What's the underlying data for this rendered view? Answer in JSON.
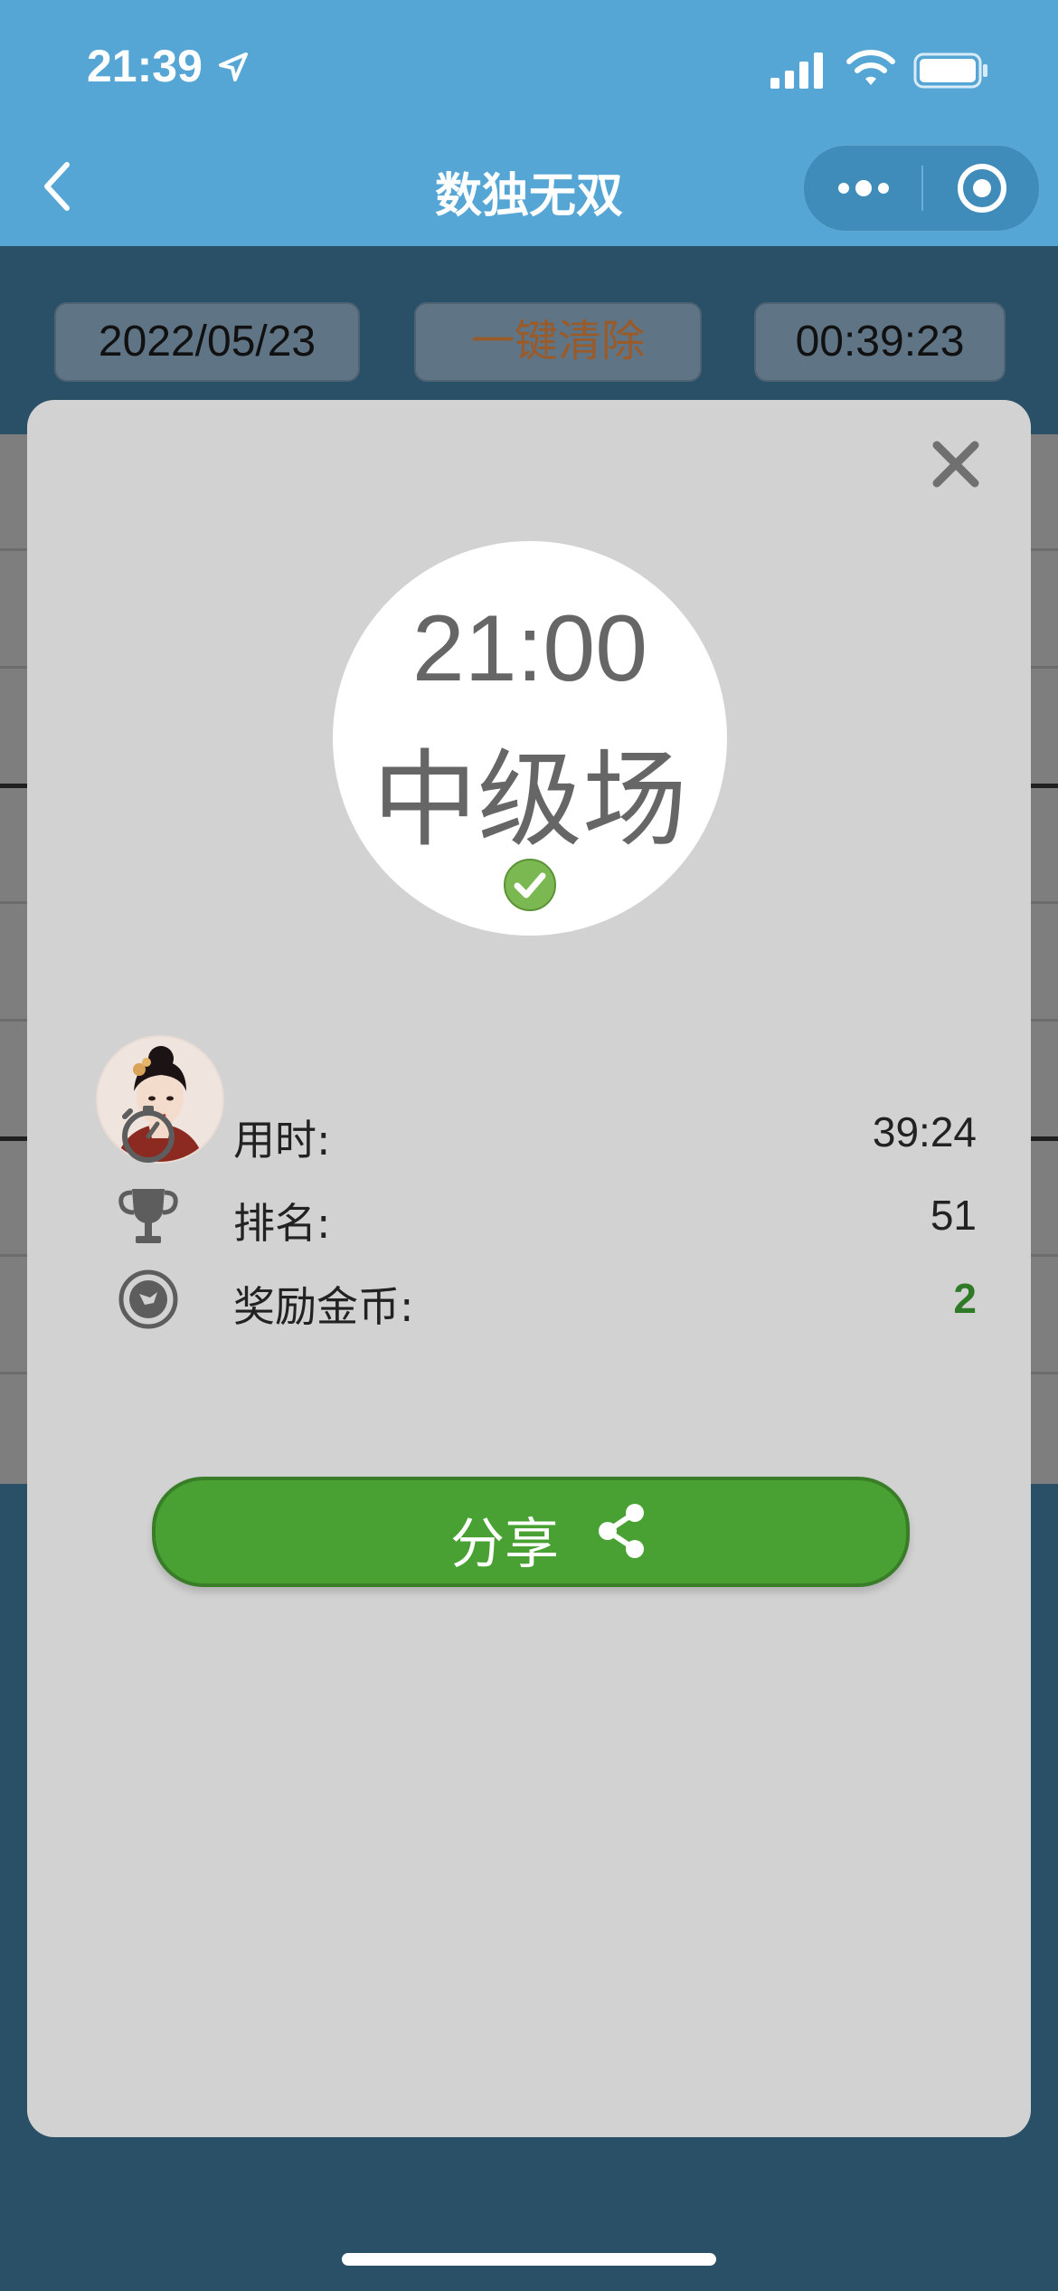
{
  "status_bar": {
    "time": "21:39"
  },
  "nav": {
    "title": "数独无双"
  },
  "toolbar": {
    "date": "2022/05/23",
    "clear_label": "一键清除",
    "timer": "00:39:23"
  },
  "result": {
    "session_time": "21:00",
    "session_level": "中级场",
    "stats": [
      {
        "label": "用时:",
        "value": "39:24",
        "icon": "stopwatch-icon"
      },
      {
        "label": "排名:",
        "value": "51",
        "icon": "trophy-icon"
      },
      {
        "label": "奖励金币:",
        "value": "2",
        "icon": "coin-icon"
      }
    ],
    "share_label": "分享"
  },
  "colors": {
    "nav_bg": "#55a6d5",
    "page_bg": "#2a5068",
    "modal_bg": "#d2d2d2",
    "share_green": "#48a132",
    "reward_green": "#2f7a27"
  }
}
